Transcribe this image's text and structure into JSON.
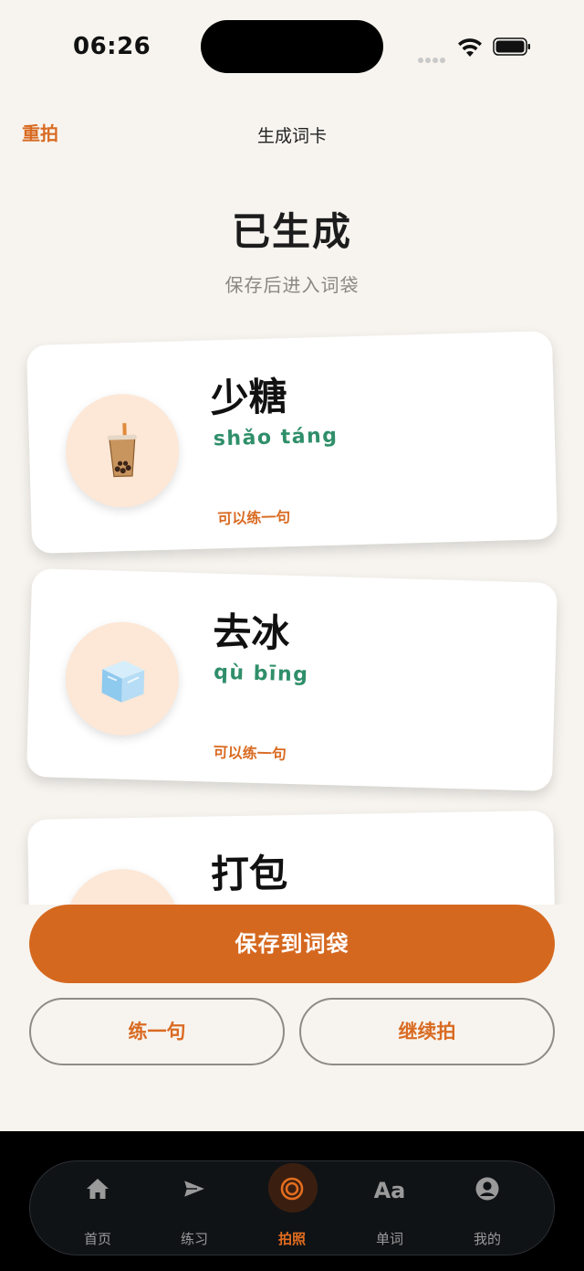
{
  "status": {
    "time": "06:26"
  },
  "nav": {
    "back_label": "重拍",
    "title": "生成词卡"
  },
  "hero": {
    "title": "已生成",
    "subtitle": "保存后进入词袋"
  },
  "cards": [
    {
      "word": "少糖",
      "pinyin": "shǎo táng",
      "action": "可以练一句",
      "icon": "bubble-tea-icon"
    },
    {
      "word": "去冰",
      "pinyin": "qù bīng",
      "action": "可以练一句",
      "icon": "ice-cube-icon"
    },
    {
      "word": "打包",
      "icon": "takeout-box-icon"
    }
  ],
  "buttons": {
    "save": "保存到词袋",
    "practice": "练一句",
    "continue": "继续拍"
  },
  "tabbar": {
    "items": [
      {
        "label": "首页",
        "icon": "home-icon"
      },
      {
        "label": "练习",
        "icon": "send-icon"
      },
      {
        "label": "拍照",
        "icon": "camera-ring-icon",
        "active": true
      },
      {
        "label": "单词",
        "icon_text": "Aa"
      },
      {
        "label": "我的",
        "icon": "profile-icon"
      }
    ]
  },
  "colors": {
    "accent": "#d5681f",
    "pinyin": "#2f8f6a",
    "background": "#f7f4ef"
  }
}
